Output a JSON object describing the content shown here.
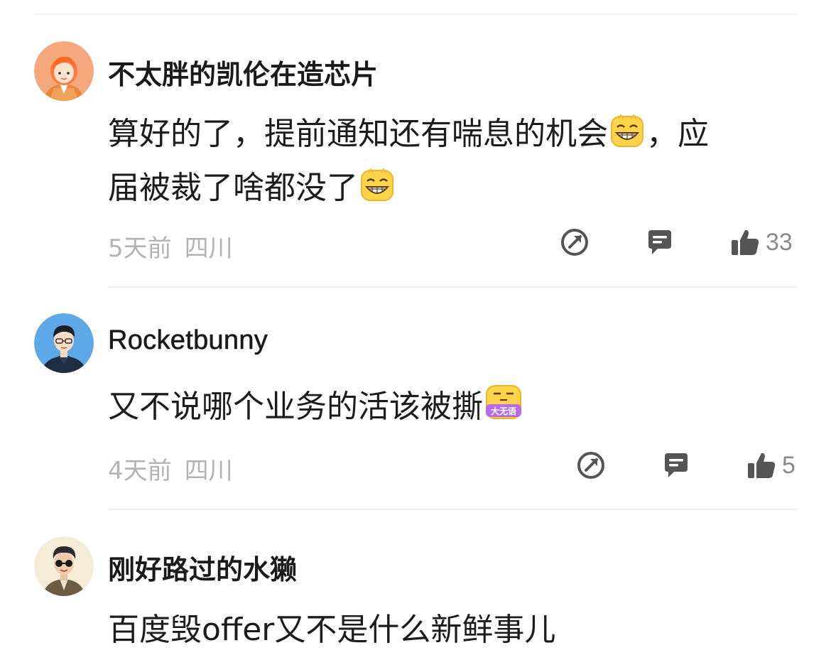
{
  "comments": [
    {
      "username": "不太胖的凯伦在造芯片",
      "line1": "算好的了，提前通知还有喘息的机会",
      "line1_tail": "，应",
      "line2": "届被裁了啥都没了",
      "emoji": "grin-emoji",
      "time": "5天前",
      "location": "四川",
      "likes": "33"
    },
    {
      "username": "Rocketbunny",
      "line1": "又不说哪个业务的活该被撕",
      "emoji_label": "大无语",
      "time": "4天前",
      "location": "四川",
      "likes": "5"
    },
    {
      "username": "刚好路过的水獭",
      "line1": "百度毁offer又不是什么新鲜事儿"
    }
  ],
  "colors": {
    "text": "#1c1c1c",
    "meta": "#b3b3b3",
    "icon": "#555555",
    "divider": "#f0f0f0"
  }
}
